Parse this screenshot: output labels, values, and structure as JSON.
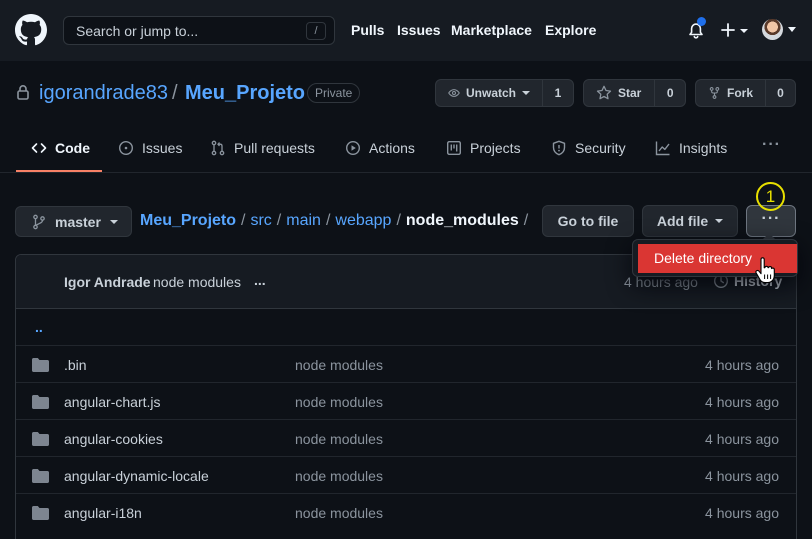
{
  "header": {
    "search_placeholder": "Search or jump to...",
    "search_shortcut": "/",
    "nav": [
      "Pulls",
      "Issues",
      "Marketplace",
      "Explore"
    ]
  },
  "repo": {
    "owner": "igorandrade83",
    "separator": "/",
    "name": "Meu_Projeto",
    "visibility": "Private",
    "unwatch_label": "Unwatch",
    "unwatch_count": "1",
    "star_label": "Star",
    "star_count": "0",
    "fork_label": "Fork",
    "fork_count": "0"
  },
  "tabs": [
    {
      "label": "Code",
      "icon": "code-icon",
      "active": true
    },
    {
      "label": "Issues",
      "icon": "issue-icon"
    },
    {
      "label": "Pull requests",
      "icon": "pull-request-icon"
    },
    {
      "label": "Actions",
      "icon": "play-icon"
    },
    {
      "label": "Projects",
      "icon": "project-icon"
    },
    {
      "label": "Security",
      "icon": "shield-icon"
    },
    {
      "label": "Insights",
      "icon": "graph-icon"
    }
  ],
  "tabs_more": "···",
  "file_nav": {
    "branch": "master",
    "breadcrumb": [
      "Meu_Projeto",
      "src",
      "main",
      "webapp",
      "node_modules"
    ],
    "trailing_separator": "/",
    "go_to_file": "Go to file",
    "add_file": "Add file",
    "more": "···",
    "step_marker": "1"
  },
  "dropdown": {
    "items": [
      "Delete directory"
    ]
  },
  "commit": {
    "author": "Igor Andrade",
    "message": "node modules",
    "ellipsis": "...",
    "time": "4 hours ago",
    "history": "History"
  },
  "files": {
    "parent": "..",
    "rows": [
      {
        "name": ".bin",
        "message": "node modules",
        "age": "4 hours ago"
      },
      {
        "name": "angular-chart.js",
        "message": "node modules",
        "age": "4 hours ago"
      },
      {
        "name": "angular-cookies",
        "message": "node modules",
        "age": "4 hours ago"
      },
      {
        "name": "angular-dynamic-locale",
        "message": "node modules",
        "age": "4 hours ago"
      },
      {
        "name": "angular-i18n",
        "message": "node modules",
        "age": "4 hours ago"
      }
    ]
  },
  "colors": {
    "background": "#0d1117",
    "header": "#161b22",
    "link": "#58a6ff",
    "danger": "#da3633",
    "tab_accent": "#f78166",
    "marker": "#e8e000"
  }
}
